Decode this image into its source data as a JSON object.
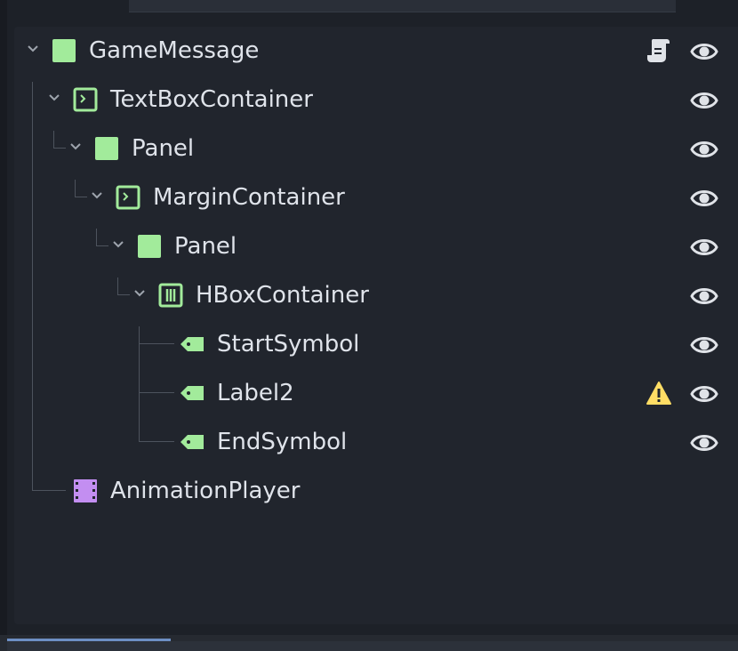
{
  "scene_tree": {
    "nodes": [
      {
        "name": "GameMessage",
        "type_icon": "panel-icon",
        "expanded": true,
        "extra_icon": "script-icon",
        "visible": true
      },
      {
        "name": "TextBoxContainer",
        "type_icon": "container-icon",
        "expanded": true,
        "visible": true
      },
      {
        "name": "Panel",
        "type_icon": "panel-icon",
        "expanded": true,
        "visible": true
      },
      {
        "name": "MarginContainer",
        "type_icon": "container-icon",
        "expanded": true,
        "visible": true
      },
      {
        "name": "Panel",
        "type_icon": "panel-icon",
        "expanded": true,
        "visible": true
      },
      {
        "name": "HBoxContainer",
        "type_icon": "hbox-container-icon",
        "expanded": true,
        "visible": true
      },
      {
        "name": "StartSymbol",
        "type_icon": "label-icon",
        "visible": true
      },
      {
        "name": "Label2",
        "type_icon": "label-icon",
        "extra_icon": "warning-icon",
        "visible": true
      },
      {
        "name": "EndSymbol",
        "type_icon": "label-icon",
        "visible": true
      },
      {
        "name": "AnimationPlayer",
        "type_icon": "animation-player-icon"
      }
    ]
  },
  "colors": {
    "background": "#1d2128",
    "panel": "#21252d",
    "node_green": "#a2eb9b",
    "node_purple": "#c38ef1",
    "warning": "#ffdd65",
    "eye": "#e0e3e8",
    "guide": "#4d535d"
  }
}
